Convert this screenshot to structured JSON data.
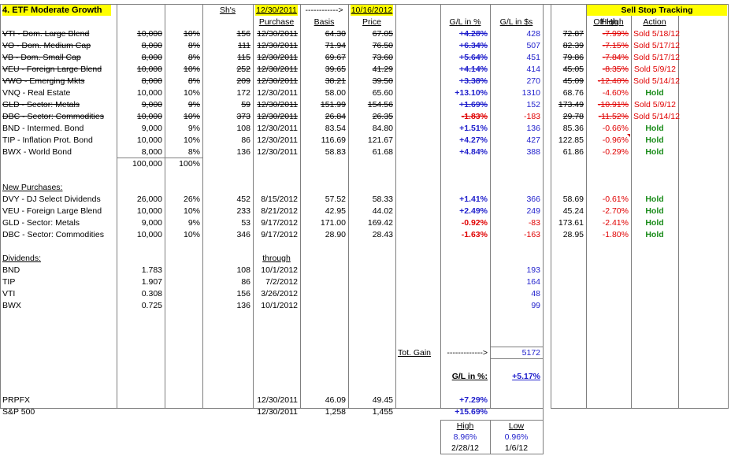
{
  "title": "4. ETF Moderate Growth",
  "header": {
    "start_date": "12/30/2011",
    "arrow": "------------>",
    "end_date": "10/16/2012",
    "shs": "Sh's",
    "purchase": "Purchase",
    "basis": "Basis",
    "price": "Price",
    "gl_pct": "G/L in %",
    "gl_usd": "G/L in $s"
  },
  "stop": {
    "title": "Sell Stop Tracking",
    "high": "High",
    "off_high": "Off High",
    "action": "Action"
  },
  "holdings": [
    {
      "name": "VTI - Dom. Large Blend",
      "amount": "10,000",
      "pct": "10%",
      "shs": "156",
      "date": "12/30/2011",
      "basis": "64.30",
      "price": "67.05",
      "glp": "+4.28%",
      "gld": "428",
      "high": "72.87",
      "off": "-7.99%",
      "action": "Sold 5/18/12",
      "sold": true
    },
    {
      "name": "VO - Dom. Medium Cap",
      "amount": "8,000",
      "pct": "8%",
      "shs": "111",
      "date": "12/30/2011",
      "basis": "71.94",
      "price": "76.50",
      "glp": "+6.34%",
      "gld": "507",
      "high": "82.39",
      "off": "-7.15%",
      "action": "Sold 5/17/12",
      "sold": true
    },
    {
      "name": "VB - Dom. Small Cap",
      "amount": "8,000",
      "pct": "8%",
      "shs": "115",
      "date": "12/30/2011",
      "basis": "69.67",
      "price": "73.60",
      "glp": "+5.64%",
      "gld": "451",
      "high": "79.86",
      "off": "-7.84%",
      "action": "Sold 5/17/12",
      "sold": true
    },
    {
      "name": "VEU - Foreign Large Blend",
      "amount": "10,000",
      "pct": "10%",
      "shs": "252",
      "date": "12/30/2011",
      "basis": "39.65",
      "price": "41.29",
      "glp": "+4.14%",
      "gld": "414",
      "high": "45.05",
      "off": "-8.35%",
      "action": "Sold 5/9/12",
      "sold": true
    },
    {
      "name": "VWO - Emerging Mkts",
      "amount": "8,000",
      "pct": "8%",
      "shs": "209",
      "date": "12/30/2011",
      "basis": "38.21",
      "price": "39.50",
      "glp": "+3.38%",
      "gld": "270",
      "high": "45.09",
      "off": "-12.40%",
      "action": "Sold 5/14/12",
      "sold": true
    },
    {
      "name": "VNQ - Real Estate",
      "amount": "10,000",
      "pct": "10%",
      "shs": "172",
      "date": "12/30/2011",
      "basis": "58.00",
      "price": "65.60",
      "glp": "+13.10%",
      "gld": "1310",
      "high": "68.76",
      "off": "-4.60%",
      "action": "Hold",
      "sold": false
    },
    {
      "name": "GLD - Sector: Metals",
      "amount": "9,000",
      "pct": "9%",
      "shs": "59",
      "date": "12/30/2011",
      "basis": "151.99",
      "price": "154.56",
      "glp": "+1.69%",
      "gld": "152",
      "high": "173.49",
      "off": "-10.91%",
      "action": "Sold 5/9/12",
      "sold": true
    },
    {
      "name": "DBC - Sector: Commodities",
      "amount": "10,000",
      "pct": "10%",
      "shs": "373",
      "date": "12/30/2011",
      "basis": "26.84",
      "price": "26.35",
      "glp": "-1.83%",
      "gld": "-183",
      "high": "29.78",
      "off": "-11.52%",
      "action": "Sold 5/14/12",
      "sold": true
    },
    {
      "name": "BND - Intermed. Bond",
      "amount": "9,000",
      "pct": "9%",
      "shs": "108",
      "date": "12/30/2011",
      "basis": "83.54",
      "price": "84.80",
      "glp": "+1.51%",
      "gld": "136",
      "high": "85.36",
      "off": "-0.66%",
      "action": "Hold",
      "sold": false
    },
    {
      "name": "TIP - Inflation Prot. Bond",
      "amount": "10,000",
      "pct": "10%",
      "shs": "86",
      "date": "12/30/2011",
      "basis": "116.69",
      "price": "121.67",
      "glp": "+4.27%",
      "gld": "427",
      "high": "122.85",
      "off": "-0.96%",
      "action": "Hold",
      "sold": false
    },
    {
      "name": "BWX - World Bond",
      "amount": "8,000",
      "pct": "8%",
      "shs": "136",
      "date": "12/30/2011",
      "basis": "58.83",
      "price": "61.68",
      "glp": "+4.84%",
      "gld": "388",
      "high": "61.86",
      "off": "-0.29%",
      "action": "Hold",
      "sold": false
    }
  ],
  "totals": {
    "amount": "100,000",
    "pct": "100%"
  },
  "new_purchases_label": "New Purchases:",
  "new_purchases": [
    {
      "name": "DVY - DJ Select Dividends",
      "amount": "26,000",
      "pct": "26%",
      "shs": "452",
      "date": "8/15/2012",
      "basis": "57.52",
      "price": "58.33",
      "glp": "+1.41%",
      "gld": "366",
      "high": "58.69",
      "off": "-0.61%",
      "action": "Hold"
    },
    {
      "name": "VEU - Foreign Large Blend",
      "amount": "10,000",
      "pct": "10%",
      "shs": "233",
      "date": "8/21/2012",
      "basis": "42.95",
      "price": "44.02",
      "glp": "+2.49%",
      "gld": "249",
      "high": "45.24",
      "off": "-2.70%",
      "action": "Hold"
    },
    {
      "name": "GLD - Sector: Metals",
      "amount": "9,000",
      "pct": "9%",
      "shs": "53",
      "date": "9/17/2012",
      "basis": "171.00",
      "price": "169.42",
      "glp": "-0.92%",
      "gld": "-83",
      "high": "173.61",
      "off": "-2.41%",
      "action": "Hold"
    },
    {
      "name": "DBC - Sector: Commodities",
      "amount": "10,000",
      "pct": "10%",
      "shs": "346",
      "date": "9/17/2012",
      "basis": "28.90",
      "price": "28.43",
      "glp": "-1.63%",
      "gld": "-163",
      "high": "28.95",
      "off": "-1.80%",
      "action": "Hold"
    }
  ],
  "dividends_label": "Dividends:",
  "through_label": "through",
  "dividends": [
    {
      "name": "BND",
      "rate": "1.783",
      "shs": "108",
      "date": "10/1/2012",
      "gld": "193"
    },
    {
      "name": "TIP",
      "rate": "1.907",
      "shs": "86",
      "date": "7/2/2012",
      "gld": "164"
    },
    {
      "name": "VTI",
      "rate": "0.308",
      "shs": "156",
      "date": "3/26/2012",
      "gld": "48"
    },
    {
      "name": "BWX",
      "rate": "0.725",
      "shs": "136",
      "date": "10/1/2012",
      "gld": "99"
    }
  ],
  "tot_gain": {
    "label": "Tot. Gain",
    "arrow": "------------->",
    "value": "5172"
  },
  "gl_pct_total": {
    "label": "G/L in %:",
    "value": "+5.17%"
  },
  "benchmarks": [
    {
      "name": "PRPFX",
      "date": "12/30/2011",
      "basis": "46.09",
      "price": "49.45",
      "glp": "+7.29%"
    },
    {
      "name": "S&P 500",
      "date": "12/30/2011",
      "basis": "1,258",
      "price": "1,455",
      "glp": "+15.69%"
    }
  ],
  "range": {
    "high_label": "High",
    "low_label": "Low",
    "high_pct": "8.96%",
    "low_pct": "0.96%",
    "high_date": "2/28/12",
    "low_date": "1/6/12"
  }
}
